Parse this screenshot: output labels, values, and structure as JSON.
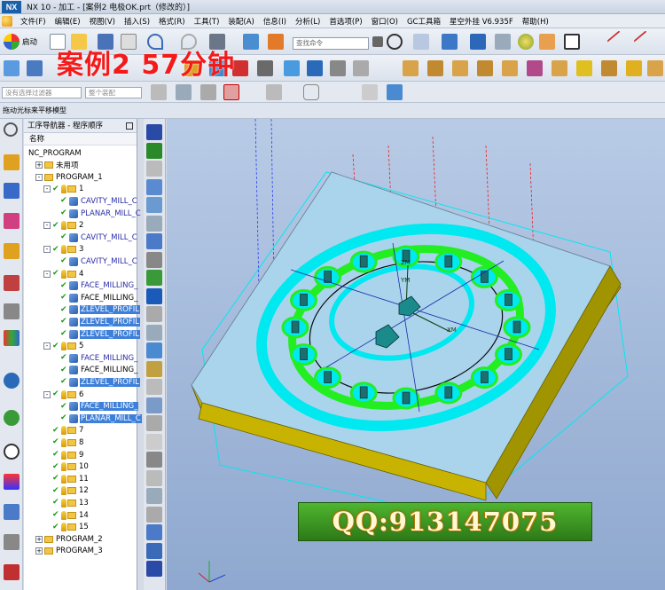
{
  "app": {
    "logo": "NX",
    "title": "NX 10 - 加工 - [案例2 电极OK.prt（修改的）]"
  },
  "menu": [
    "文件(F)",
    "编辑(E)",
    "视图(V)",
    "插入(S)",
    "格式(R)",
    "工具(T)",
    "装配(A)",
    "信息(I)",
    "分析(L)",
    "首选项(P)",
    "窗口(O)",
    "GC工具箱",
    "星空外挂 V6.935F",
    "帮助(H)"
  ],
  "toolbar": {
    "start_label": "启动",
    "search_placeholder": "查找命令",
    "filter_placeholder": "没有选择过滤器",
    "assembly_placeholder": "整个装配"
  },
  "overlay": {
    "watermark": "案例2   57分钟",
    "qq": "QQ:913147075"
  },
  "statusbar": {
    "hint": "拖动光标来平移模型"
  },
  "navigator": {
    "title": "工序导航器 - 程序顺序",
    "column": "名称",
    "rows": [
      {
        "level": 0,
        "text": "NC_PROGRAM",
        "type": "root"
      },
      {
        "level": 1,
        "text": "未用项",
        "type": "folder",
        "exp": "+"
      },
      {
        "level": 1,
        "text": "PROGRAM_1",
        "type": "folder",
        "exp": "-"
      },
      {
        "level": 2,
        "text": "1",
        "type": "group",
        "exp": "-"
      },
      {
        "level": 3,
        "text": "CAVITY_MILL_C",
        "type": "op"
      },
      {
        "level": 3,
        "text": "PLANAR_MILL_C",
        "type": "op"
      },
      {
        "level": 2,
        "text": "2",
        "type": "group",
        "exp": "-"
      },
      {
        "level": 3,
        "text": "CAVITY_MILL_C",
        "type": "op"
      },
      {
        "level": 2,
        "text": "3",
        "type": "group",
        "exp": "-"
      },
      {
        "level": 3,
        "text": "CAVITY_MILL_C",
        "type": "op"
      },
      {
        "level": 2,
        "text": "4",
        "type": "group",
        "exp": "-"
      },
      {
        "level": 3,
        "text": "FACE_MILLING_",
        "type": "op"
      },
      {
        "level": 3,
        "text": "FACE_MILLING_",
        "type": "opb"
      },
      {
        "level": 3,
        "text": "ZLEVEL_PROFIL",
        "type": "sel"
      },
      {
        "level": 3,
        "text": "ZLEVEL_PROFIL",
        "type": "sel"
      },
      {
        "level": 3,
        "text": "ZLEVEL_PROFIL",
        "type": "sel"
      },
      {
        "level": 2,
        "text": "5",
        "type": "group",
        "exp": "-"
      },
      {
        "level": 3,
        "text": "FACE_MILLING_",
        "type": "op"
      },
      {
        "level": 3,
        "text": "FACE_MILLING_",
        "type": "opb"
      },
      {
        "level": 3,
        "text": "ZLEVEL_PROFIL",
        "type": "sel"
      },
      {
        "level": 2,
        "text": "6",
        "type": "group",
        "exp": "-"
      },
      {
        "level": 3,
        "text": "FACE_MILLING_",
        "type": "sel"
      },
      {
        "level": 3,
        "text": "PLANAR_MILL_C",
        "type": "sel"
      },
      {
        "level": 2,
        "text": "7",
        "type": "group"
      },
      {
        "level": 2,
        "text": "8",
        "type": "group"
      },
      {
        "level": 2,
        "text": "9",
        "type": "group"
      },
      {
        "level": 2,
        "text": "10",
        "type": "group"
      },
      {
        "level": 2,
        "text": "11",
        "type": "group"
      },
      {
        "level": 2,
        "text": "12",
        "type": "group"
      },
      {
        "level": 2,
        "text": "13",
        "type": "group"
      },
      {
        "level": 2,
        "text": "14",
        "type": "group"
      },
      {
        "level": 2,
        "text": "15",
        "type": "group"
      },
      {
        "level": 1,
        "text": "PROGRAM_2",
        "type": "folder",
        "exp": "+"
      },
      {
        "level": 1,
        "text": "PROGRAM_3",
        "type": "folder",
        "exp": "+"
      }
    ]
  },
  "viewport": {
    "axis_labels": [
      "ZM",
      "YM",
      "XM"
    ]
  },
  "colors": {
    "toolpath_cyan": "#00e8f0",
    "toolpath_green": "#22ee22",
    "part_top": "#a9d4ec",
    "part_side": "#b8a800",
    "selection": "#3d7fd9"
  }
}
